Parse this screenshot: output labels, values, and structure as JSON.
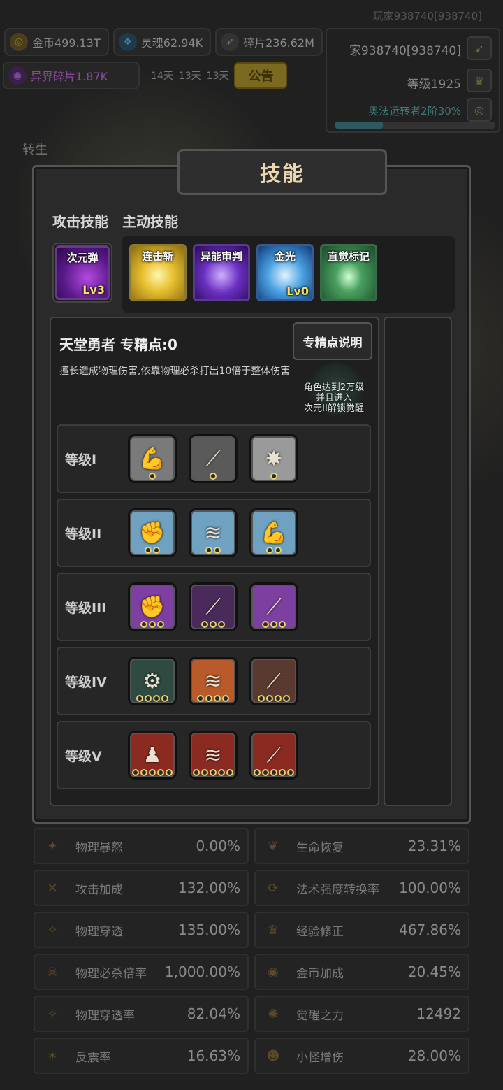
{
  "header": {
    "player_id": "玩家938740[938740]",
    "resources": [
      {
        "icon": "coin-icon",
        "label": "金币499.13T"
      },
      {
        "icon": "soul-icon",
        "label": "灵魂62.94K"
      },
      {
        "icon": "shard-icon",
        "label": "碎片236.62M"
      }
    ],
    "alien_shards": "异界碎片1.87K",
    "timers": [
      "14天",
      "13天",
      "13天"
    ],
    "notice_button": "公告",
    "rebirth_label": "转生"
  },
  "profile": {
    "name": "家938740[938740]",
    "level": "等级1925",
    "class": "奥法运转者2阶30%",
    "progress_fraction": 0.3
  },
  "modal": {
    "title": "技能",
    "tabs": [
      "攻击技能",
      "主动技能"
    ],
    "attack_skill": {
      "name": "次元弹",
      "level": "Lv3"
    },
    "active_skills": [
      {
        "name": "连击斩",
        "level": ""
      },
      {
        "name": "异能审判",
        "level": ""
      },
      {
        "name": "金光",
        "level": "Lv0"
      },
      {
        "name": "直觉标记",
        "level": ""
      }
    ],
    "detail": {
      "title": "天堂勇者 专精点:0",
      "explain_button": "专精点说明",
      "description": "擅长造成物理伤害,依靠物理必杀打出10倍于整体伤害",
      "awaken_note": "角色达到2万级\n并且进入\n次元II解锁觉醒"
    },
    "tiers": [
      {
        "label": "等级I",
        "dots": 1
      },
      {
        "label": "等级II",
        "dots": 2
      },
      {
        "label": "等级III",
        "dots": 3
      },
      {
        "label": "等级IV",
        "dots": 4
      },
      {
        "label": "等级V",
        "dots": 5
      }
    ]
  },
  "stats": [
    {
      "label": "物理暴怒",
      "value": "0.00%"
    },
    {
      "label": "生命恢复",
      "value": "23.31%"
    },
    {
      "label": "攻击加成",
      "value": "132.00%"
    },
    {
      "label": "法术强度转换率",
      "value": "100.00%"
    },
    {
      "label": "物理穿透",
      "value": "135.00%"
    },
    {
      "label": "经验修正",
      "value": "467.86%"
    },
    {
      "label": "物理必杀倍率",
      "value": "1,000.00%"
    },
    {
      "label": "金币加成",
      "value": "20.45%"
    },
    {
      "label": "物理穿透率",
      "value": "82.04%"
    },
    {
      "label": "觉醒之力",
      "value": "12492"
    },
    {
      "label": "反震率",
      "value": "16.63%"
    },
    {
      "label": "小怪增伤",
      "value": "28.00%"
    }
  ],
  "colors": {
    "accent_gold": "#e8d36a",
    "title_text": "#ead7b0",
    "tier_blue": "#6fa2c0",
    "tier_purple": "#7d3fa0",
    "tier_orange": "#b85a2a",
    "tier_red": "#8a2a20"
  }
}
